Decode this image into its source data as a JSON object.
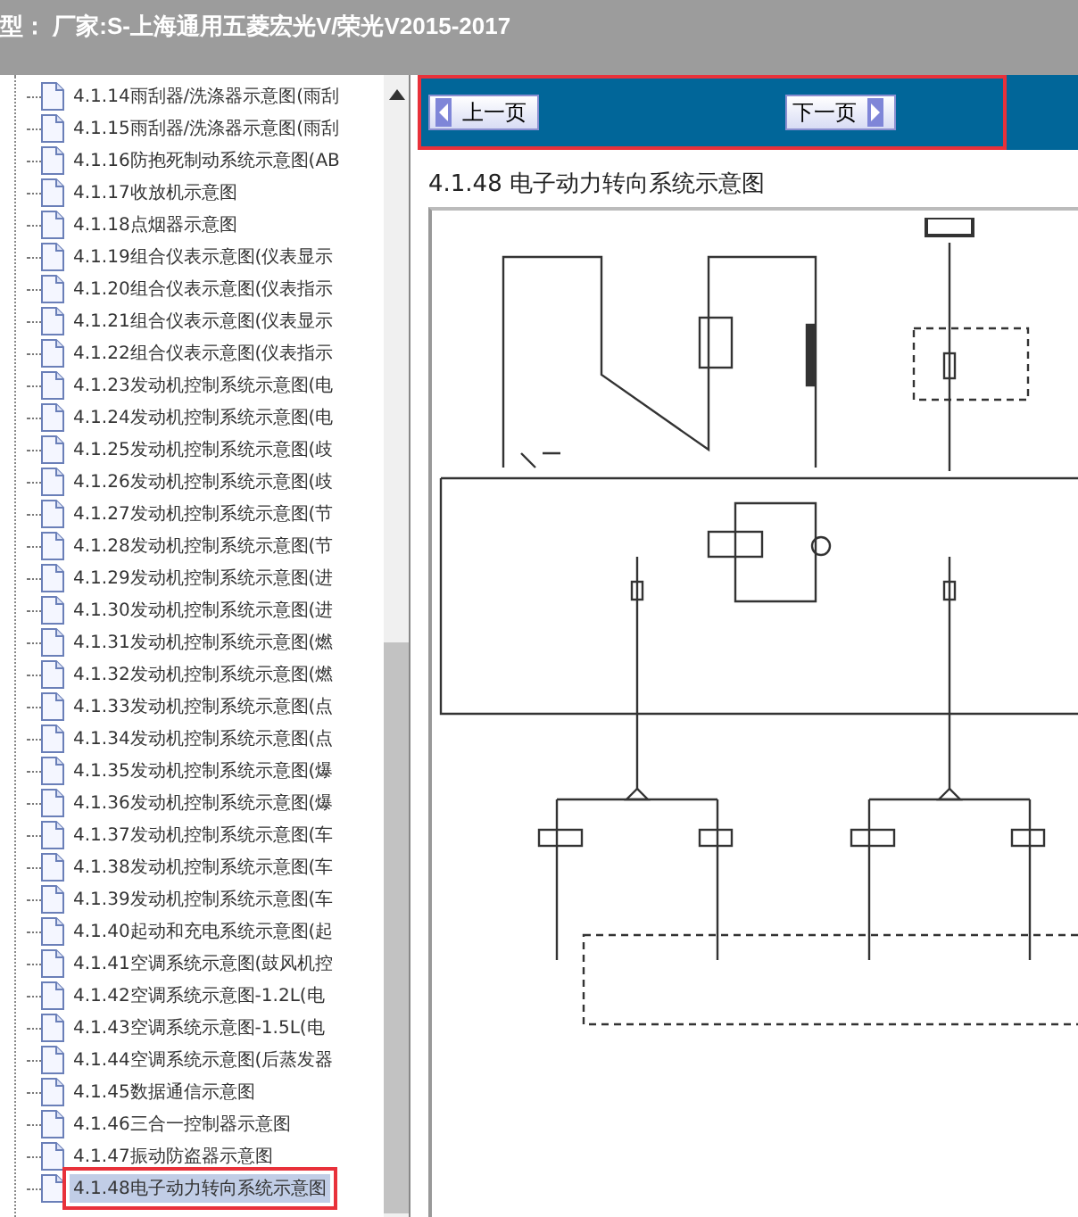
{
  "header": {
    "title": "型： 厂家:S-上海通用五菱宏光V/荣光V2015-2017"
  },
  "tree": {
    "items": [
      {
        "label": "4.1.14雨刮器/洗涤器示意图(雨刮",
        "selected": false
      },
      {
        "label": "4.1.15雨刮器/洗涤器示意图(雨刮",
        "selected": false
      },
      {
        "label": "4.1.16防抱死制动系统示意图(AB",
        "selected": false
      },
      {
        "label": "4.1.17收放机示意图",
        "selected": false
      },
      {
        "label": "4.1.18点烟器示意图",
        "selected": false
      },
      {
        "label": "4.1.19组合仪表示意图(仪表显示",
        "selected": false
      },
      {
        "label": "4.1.20组合仪表示意图(仪表指示",
        "selected": false
      },
      {
        "label": "4.1.21组合仪表示意图(仪表显示",
        "selected": false
      },
      {
        "label": "4.1.22组合仪表示意图(仪表指示",
        "selected": false
      },
      {
        "label": "4.1.23发动机控制系统示意图(电",
        "selected": false
      },
      {
        "label": "4.1.24发动机控制系统示意图(电",
        "selected": false
      },
      {
        "label": "4.1.25发动机控制系统示意图(歧",
        "selected": false
      },
      {
        "label": "4.1.26发动机控制系统示意图(歧",
        "selected": false
      },
      {
        "label": "4.1.27发动机控制系统示意图(节",
        "selected": false
      },
      {
        "label": "4.1.28发动机控制系统示意图(节",
        "selected": false
      },
      {
        "label": "4.1.29发动机控制系统示意图(进",
        "selected": false
      },
      {
        "label": "4.1.30发动机控制系统示意图(进",
        "selected": false
      },
      {
        "label": "4.1.31发动机控制系统示意图(燃",
        "selected": false
      },
      {
        "label": "4.1.32发动机控制系统示意图(燃",
        "selected": false
      },
      {
        "label": "4.1.33发动机控制系统示意图(点",
        "selected": false
      },
      {
        "label": "4.1.34发动机控制系统示意图(点",
        "selected": false
      },
      {
        "label": "4.1.35发动机控制系统示意图(爆",
        "selected": false
      },
      {
        "label": "4.1.36发动机控制系统示意图(爆",
        "selected": false
      },
      {
        "label": "4.1.37发动机控制系统示意图(车",
        "selected": false
      },
      {
        "label": "4.1.38发动机控制系统示意图(车",
        "selected": false
      },
      {
        "label": "4.1.39发动机控制系统示意图(车",
        "selected": false
      },
      {
        "label": "4.1.40起动和充电系统示意图(起",
        "selected": false
      },
      {
        "label": "4.1.41空调系统示意图(鼓风机控",
        "selected": false
      },
      {
        "label": "4.1.42空调系统示意图-1.2L(电",
        "selected": false
      },
      {
        "label": "4.1.43空调系统示意图-1.5L(电",
        "selected": false
      },
      {
        "label": "4.1.44空调系统示意图(后蒸发器",
        "selected": false
      },
      {
        "label": "4.1.45数据通信示意图",
        "selected": false
      },
      {
        "label": "4.1.46三合一控制器示意图",
        "selected": false
      },
      {
        "label": "4.1.47振动防盗器示意图",
        "selected": false
      },
      {
        "label": "4.1.48电子动力转向系统示意图",
        "selected": true
      }
    ]
  },
  "nav": {
    "prev": "上一页",
    "next": "下一页"
  },
  "page": {
    "heading": "4.1.48 电子动力转向系统示意图"
  }
}
